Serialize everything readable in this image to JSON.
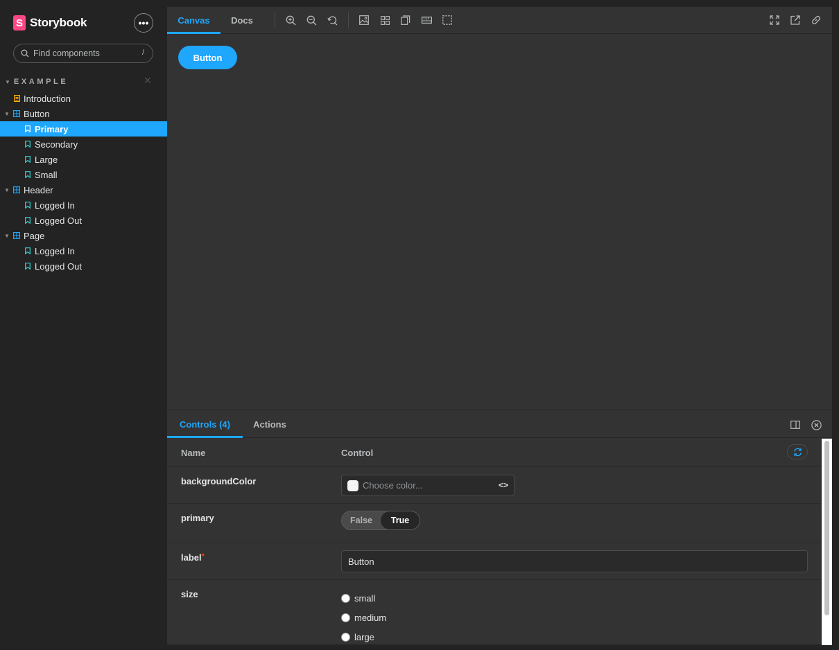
{
  "sidebar": {
    "brand": "Storybook",
    "brand_logo_letter": "S",
    "more_label": "•••",
    "search_placeholder": "Find components",
    "search_shortcut": "/",
    "group_title": "EXAMPLE",
    "items": [
      {
        "label": "Introduction",
        "type": "doc",
        "level": 0
      },
      {
        "label": "Button",
        "type": "component",
        "level": 0
      },
      {
        "label": "Primary",
        "type": "story",
        "level": 1,
        "selected": true
      },
      {
        "label": "Secondary",
        "type": "story",
        "level": 1
      },
      {
        "label": "Large",
        "type": "story",
        "level": 1
      },
      {
        "label": "Small",
        "type": "story",
        "level": 1
      },
      {
        "label": "Header",
        "type": "component",
        "level": 0
      },
      {
        "label": "Logged In",
        "type": "story",
        "level": 1
      },
      {
        "label": "Logged Out",
        "type": "story",
        "level": 1
      },
      {
        "label": "Page",
        "type": "component",
        "level": 0
      },
      {
        "label": "Logged In",
        "type": "story",
        "level": 1
      },
      {
        "label": "Logged Out",
        "type": "story",
        "level": 1
      }
    ]
  },
  "toolbar": {
    "tabs": [
      "Canvas",
      "Docs"
    ],
    "active_tab": "Canvas",
    "icons": [
      "zoom-in-icon",
      "zoom-out-icon",
      "zoom-reset-icon",
      "background-icon",
      "grid-icon",
      "viewport-icon",
      "measure-icon",
      "outline-icon",
      "fullscreen-icon",
      "open-new-tab-icon",
      "copy-link-icon"
    ]
  },
  "canvas": {
    "button_label": "Button"
  },
  "panel": {
    "tabs": [
      "Controls (4)",
      "Actions"
    ],
    "active_tab": "Controls (4)",
    "header": {
      "name": "Name",
      "control": "Control"
    },
    "rows": {
      "backgroundColor": {
        "name": "backgroundColor",
        "placeholder": "Choose color...",
        "toggle": "<>"
      },
      "primary": {
        "name": "primary",
        "false_label": "False",
        "true_label": "True",
        "value": true
      },
      "label": {
        "name": "label",
        "required_mark": "*",
        "value": "Button"
      },
      "size": {
        "name": "size",
        "options": [
          "small",
          "medium",
          "large"
        ]
      }
    }
  },
  "colors": {
    "accent": "#1ea7fd",
    "brand": "#ff4785",
    "story_icon": "#37d5d3",
    "component_icon": "#1ea7fd",
    "doc_icon": "#ffae00"
  }
}
